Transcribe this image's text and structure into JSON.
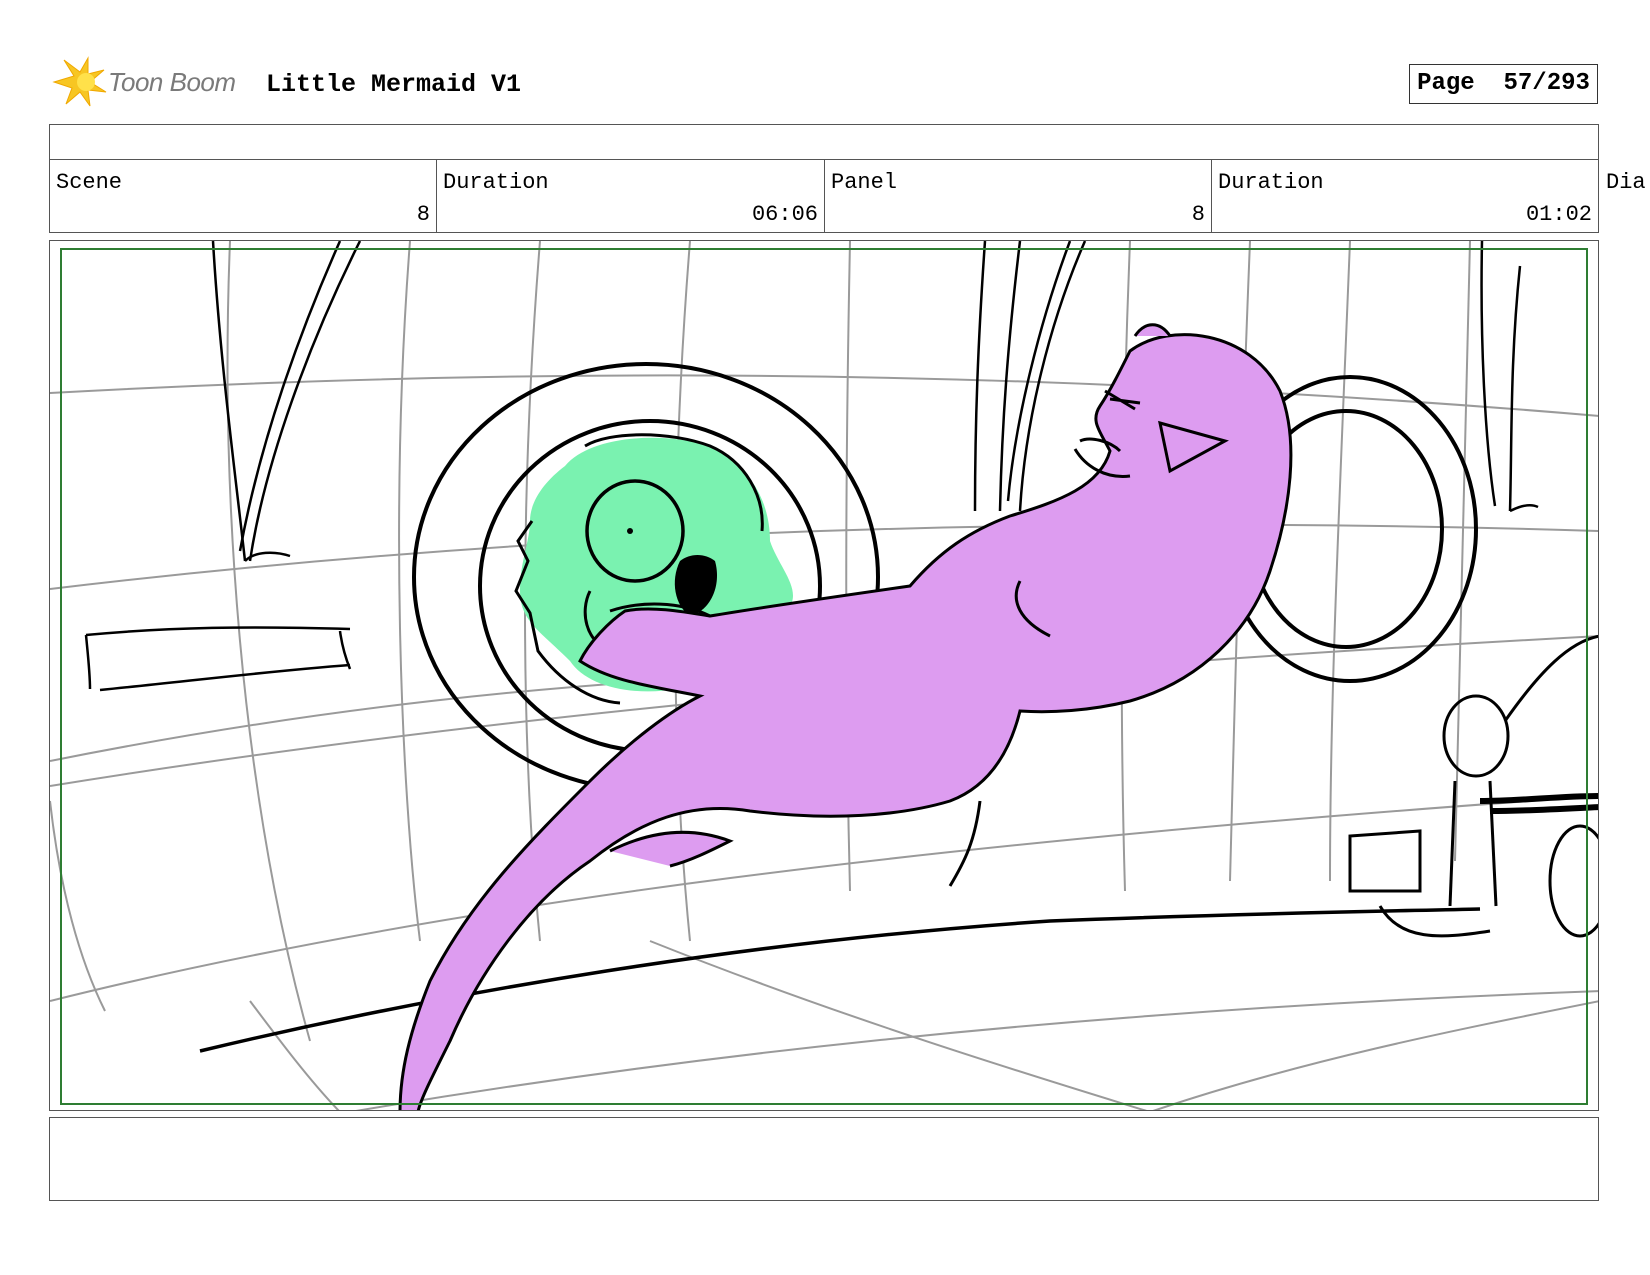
{
  "header": {
    "brand": "Toon Boom",
    "project_title": "Little Mermaid V1",
    "page_label": "Page",
    "page_value": "57/293"
  },
  "info": {
    "scene_label": "Scene",
    "scene_value": "8",
    "scene_duration_label": "Duration",
    "scene_duration_value": "06:06",
    "panel_label": "Panel",
    "panel_value": "8",
    "panel_duration_label": "Duration",
    "panel_duration_value": "01:02",
    "dialog_label": "Dia"
  },
  "colors": {
    "frame_border": "#2e7d32",
    "green_character": "#7af2b0",
    "purple_character": "#dd9cf0",
    "sketch_line": "#000000",
    "background_line": "#9a9a9a",
    "logo_star": "#f7c623"
  }
}
